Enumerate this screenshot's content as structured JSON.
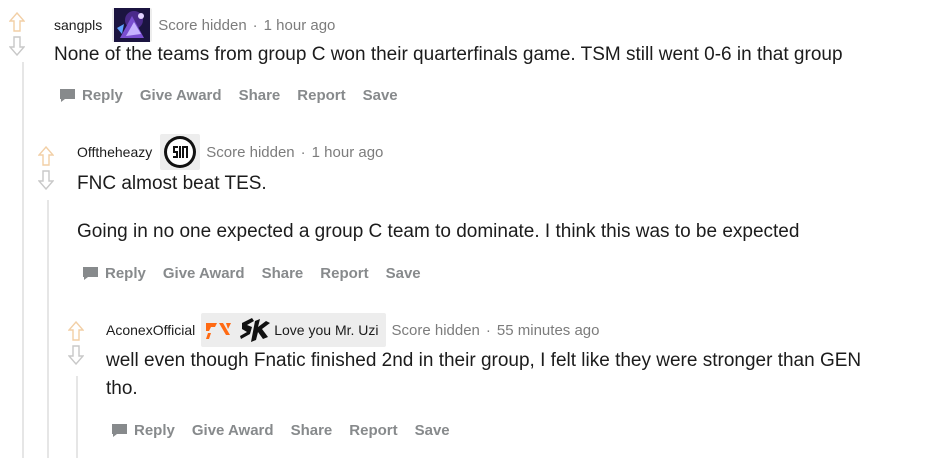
{
  "comments": [
    {
      "author": "sangpls",
      "flair_text": "",
      "score": "Score hidden",
      "separator": "·",
      "time": "1 hour ago",
      "paragraphs": [
        "None of the teams from group C won their quarterfinals game. TSM still went 0-6 in that group"
      ]
    },
    {
      "author": "Offtheheazy",
      "flair_text": "",
      "score": "Score hidden",
      "separator": "·",
      "time": "1 hour ago",
      "paragraphs": [
        "FNC almost beat TES.",
        "Going in no one expected a group C team to dominate. I think this was to be expected"
      ]
    },
    {
      "author": "AconexOfficial",
      "flair_text": "Love you Mr. Uzi",
      "score": "Score hidden",
      "separator": "·",
      "time": "55 minutes ago",
      "paragraphs": [
        "well even though Fnatic finished 2nd in their group, I felt like they were stronger than GEN",
        "tho."
      ]
    }
  ],
  "actions": {
    "reply": "Reply",
    "give_award": "Give Award",
    "share": "Share",
    "report": "Report",
    "save": "Save"
  },
  "colors": {
    "upvote": "#f7d9b8",
    "downvote": "#d2d2d2",
    "thread_line": "#e6e6e6",
    "meta_gray": "#7c7c7c",
    "action_gray": "#878a8c",
    "fnatic_orange": "#ff6a13"
  },
  "icons": [
    "upvote-arrow-icon",
    "downvote-arrow-icon",
    "speech-bubble-icon",
    "avatar-flair-icon",
    "tsm-logo-icon",
    "fnatic-logo-icon",
    "sk-gaming-logo-icon"
  ]
}
